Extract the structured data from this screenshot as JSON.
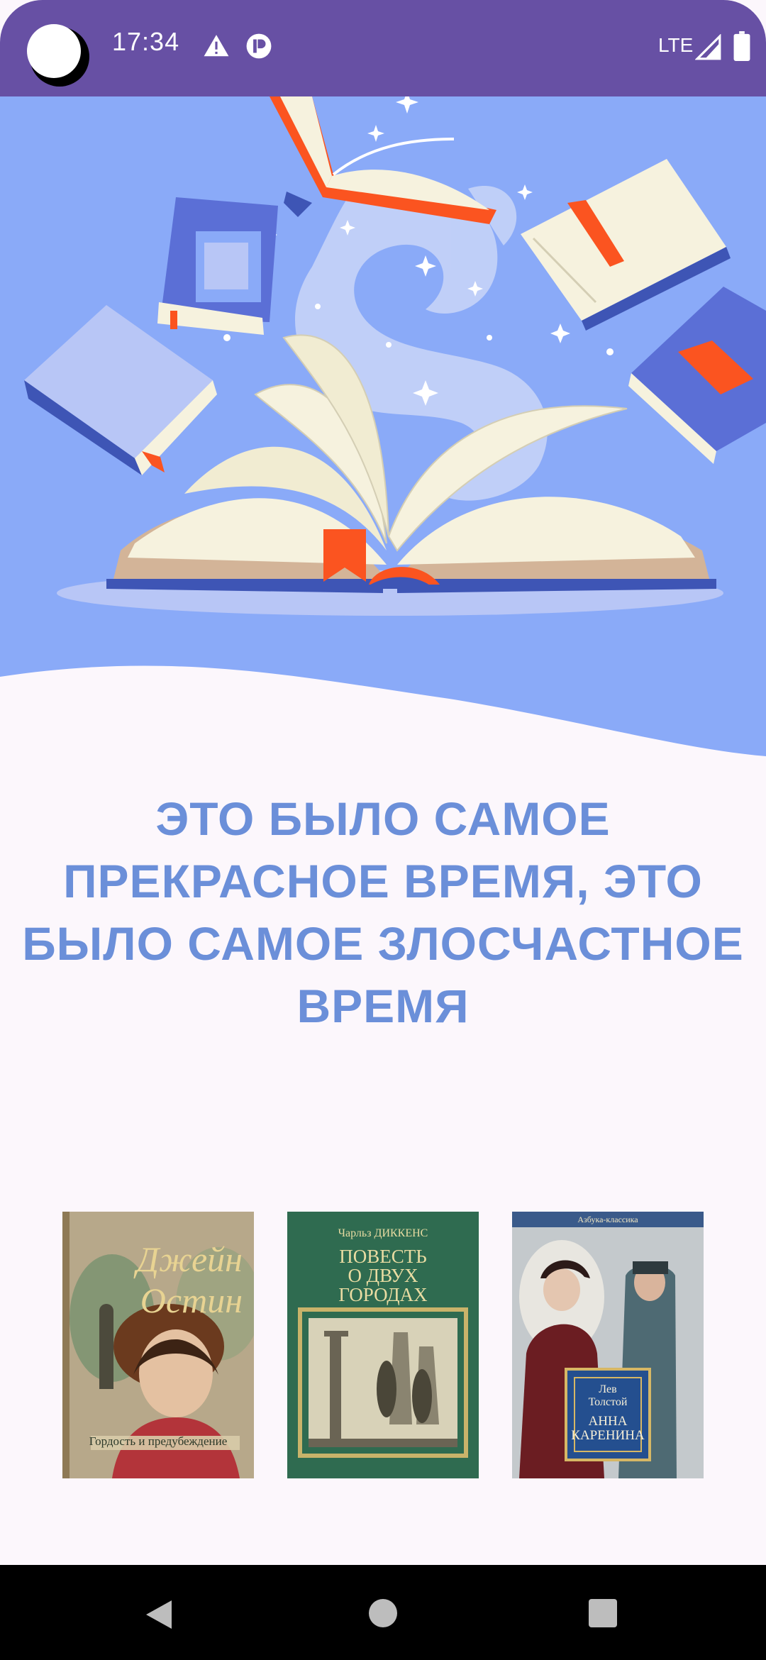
{
  "status_bar": {
    "time": "17:34",
    "network": "LTE",
    "icons": [
      "camera-cutout",
      "warning-icon",
      "app-notification-icon",
      "signal-icon",
      "battery-icon"
    ]
  },
  "hero": {
    "illustration": "open-book-with-flying-books",
    "colors": {
      "background": "#8aaaf8",
      "book_blue": "#3e55b5",
      "accent_orange": "#fb5420",
      "pages": "#f6f2de"
    }
  },
  "headline": {
    "lines": [
      "ЭТО БЫЛО САМОЕ",
      "ПРЕКРАСНОЕ ВРЕМЯ, ЭТО",
      "БЫЛО САМОЕ ЗЛОСЧАСТНОЕ",
      "ВРЕМЯ"
    ],
    "color": "#6b8fd9"
  },
  "books": [
    {
      "author": "Джейн Остин",
      "title": "Гордость и предубеждение"
    },
    {
      "author": "Чарльз ДИККЕНС",
      "title_lines": [
        "ПОВЕСТЬ",
        "О ДВУХ",
        "ГОРОДАХ"
      ]
    },
    {
      "series": "Азбука-классика",
      "author": "Лев Толстой",
      "title_lines": [
        "АННА",
        "КАРЕНИНА"
      ]
    }
  ],
  "nav_bar": {
    "buttons": [
      "back",
      "home",
      "recents"
    ]
  }
}
